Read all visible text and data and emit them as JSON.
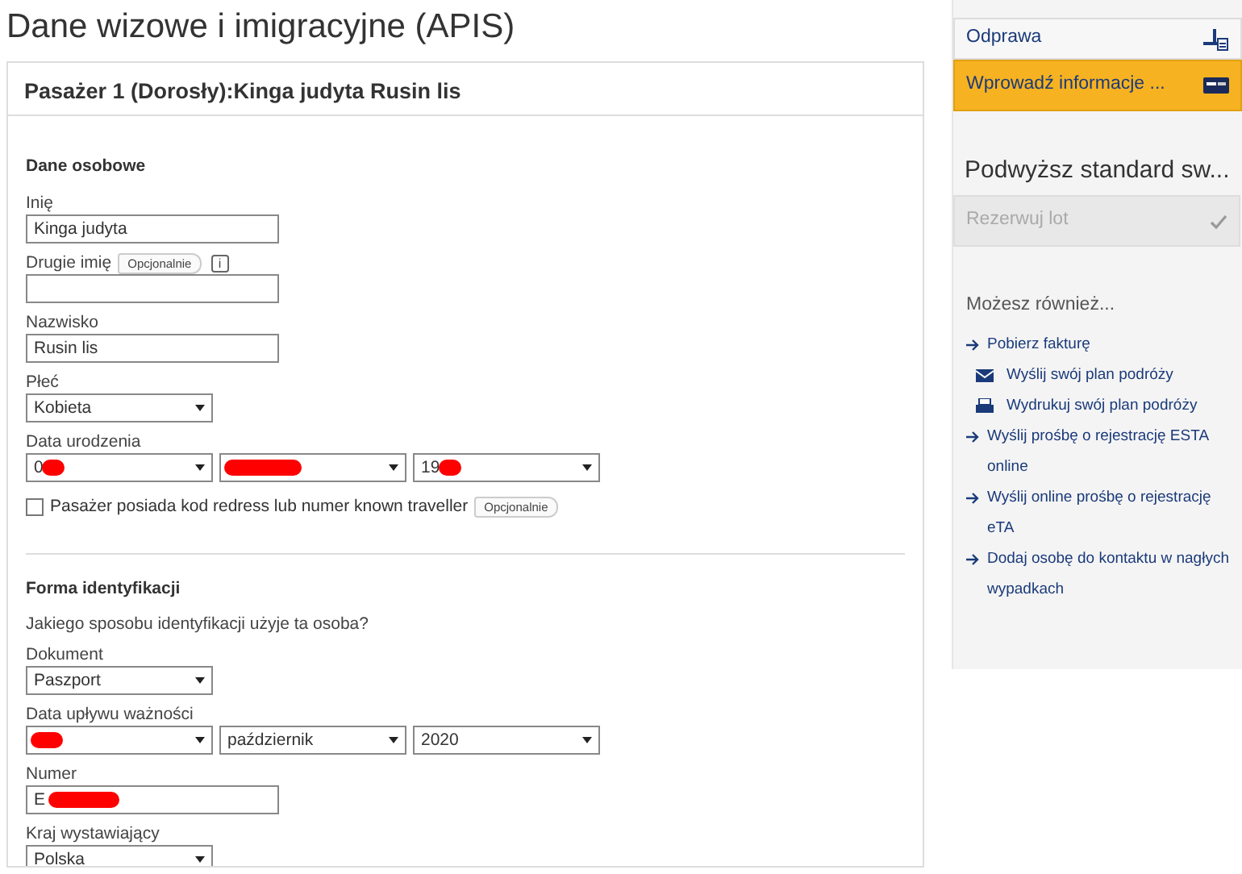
{
  "page_title": "Dane wizowe i imigracyjne (APIS)",
  "passenger_card": {
    "title": "Pasażer 1 (Dorosły):Kinga judyta Rusin lis",
    "sections": [
      {
        "heading": "Dane osobowe",
        "fields": [
          {
            "kind": "input",
            "label": "Inię",
            "value": "Kinga judyta"
          },
          {
            "kind": "input",
            "label": "Drugie imię",
            "optional_tag": "Opcjonalnie",
            "info_button": "i"
          },
          {
            "kind": "input",
            "label": "Nazwisko",
            "value": "Rusin lis"
          },
          {
            "kind": "select",
            "label": "Płeć",
            "selects": [
              {
                "value": "Kobieta"
              }
            ]
          },
          {
            "kind": "select",
            "label": "Data urodzenia",
            "selects": [
              {
                "value": "0",
                "redacted": true
              },
              {
                "redacted": true
              },
              {
                "value": "19",
                "redacted": true
              }
            ]
          },
          {
            "kind": "checkbox",
            "label": "Pasażer posiada kod redress lub numer known traveller",
            "checked": false,
            "optional_tag": "Opcjonalnie"
          }
        ]
      },
      {
        "heading": "Forma identyfikacji",
        "question": "Jakiego sposobu identyfikacji użyje ta osoba?",
        "fields": [
          {
            "kind": "select",
            "label": "Dokument",
            "selects": [
              {
                "value": "Paszport"
              }
            ]
          },
          {
            "kind": "select",
            "label": "Data upływu ważności",
            "selects": [
              {
                "redacted": true
              },
              {
                "value": "październik"
              },
              {
                "value": "2020"
              }
            ]
          },
          {
            "kind": "input",
            "label": "Numer",
            "value": "E",
            "redacted": true
          },
          {
            "kind": "select",
            "label": "Kraj wystawiający",
            "selects": [
              {
                "value": "Polska"
              }
            ]
          }
        ]
      }
    ]
  },
  "sidebar": {
    "steps": [
      {
        "label": "Odprawa",
        "selected": false,
        "kind": "checkin"
      },
      {
        "label": "Wprowadź informacje ...",
        "selected": true,
        "kind": "card"
      }
    ],
    "upgrade_heading": "Podwyższ standard sw...",
    "book_button": {
      "label": "Rezerwuj lot",
      "disabled": true
    },
    "also_heading": "Możesz również...",
    "links": [
      {
        "label": "Pobierz fakturę",
        "kind": "arrow"
      },
      {
        "label": "Wyślij swój plan podróży",
        "kind": "mail"
      },
      {
        "label": "Wydrukuj swój plan podróży",
        "kind": "print"
      },
      {
        "label": "Wyślij prośbę o rejestrację ESTA online",
        "kind": "arrow"
      },
      {
        "label": "Wyślij online prośbę o rejestrację eTA",
        "kind": "arrow"
      },
      {
        "label": "Dodaj osobę do kontaktu w nagłych wypadkach",
        "kind": "arrow"
      }
    ]
  }
}
